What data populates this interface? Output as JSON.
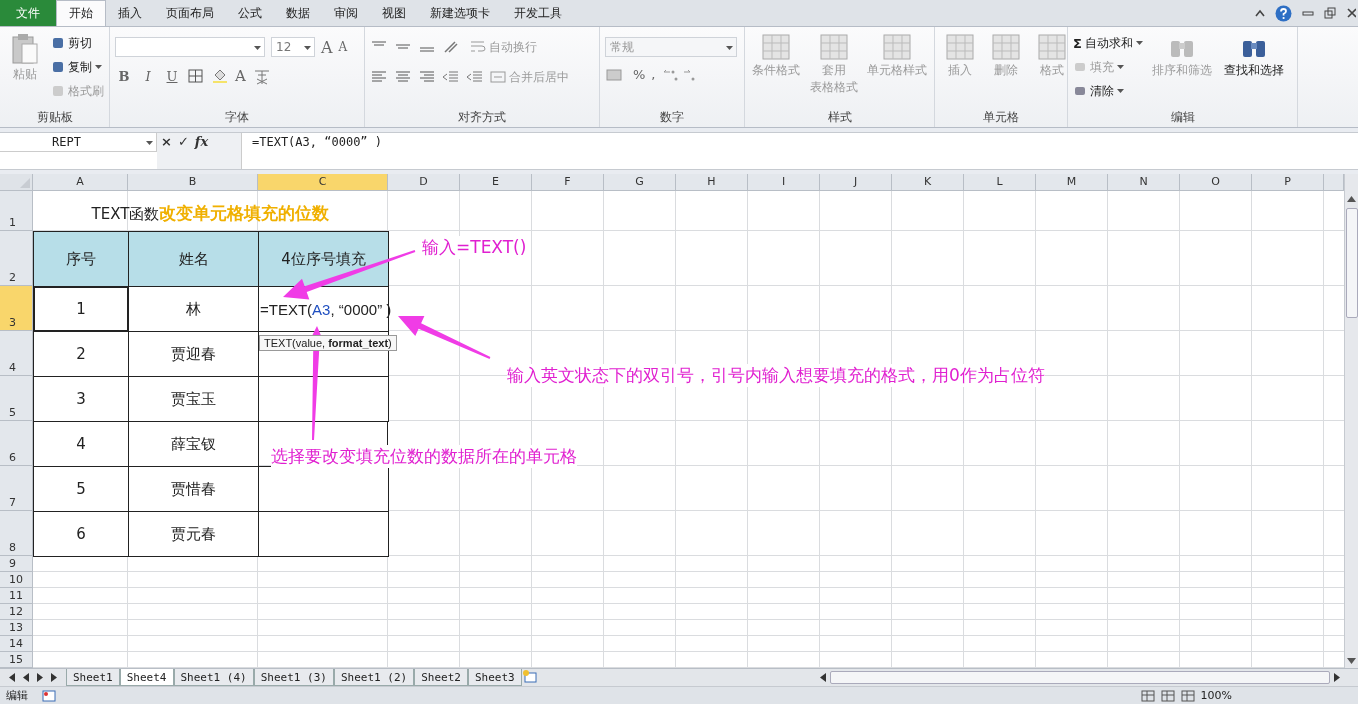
{
  "tabs": [
    {
      "label": "文件",
      "kind": "file",
      "selected": false
    },
    {
      "label": "开始",
      "kind": "tab",
      "selected": true
    },
    {
      "label": "插入",
      "kind": "tab",
      "selected": false
    },
    {
      "label": "页面布局",
      "kind": "tab",
      "selected": false
    },
    {
      "label": "公式",
      "kind": "tab",
      "selected": false
    },
    {
      "label": "数据",
      "kind": "tab",
      "selected": false
    },
    {
      "label": "审阅",
      "kind": "tab",
      "selected": false
    },
    {
      "label": "视图",
      "kind": "tab",
      "selected": false
    },
    {
      "label": "新建选项卡",
      "kind": "tab",
      "selected": false
    },
    {
      "label": "开发工具",
      "kind": "tab",
      "selected": false
    }
  ],
  "clipboard": {
    "label": "剪贴板",
    "paste": {
      "label": "粘贴",
      "disabled": true
    },
    "items": [
      {
        "label": "剪切",
        "disabled": false,
        "caret": false
      },
      {
        "label": "复制",
        "disabled": false,
        "caret": true
      },
      {
        "label": "格式刷",
        "disabled": true,
        "caret": false
      }
    ]
  },
  "font": {
    "label": "字体",
    "size": "12",
    "grow_shrink": [
      "A",
      "A"
    ],
    "styles": [
      "B",
      "I",
      "U"
    ],
    "color_letter": "A"
  },
  "alignment": {
    "label": "对齐方式",
    "wrap": {
      "label": "自动换行",
      "disabled": true
    },
    "merge": {
      "label": "合并后居中",
      "disabled": true
    }
  },
  "number": {
    "label": "数字",
    "format": "常规",
    "symbols": [
      "%",
      ","
    ]
  },
  "styles": {
    "label": "样式",
    "items": [
      {
        "lines": [
          "条件格式"
        ],
        "disabled": true
      },
      {
        "lines": [
          "套用",
          "表格格式"
        ],
        "disabled": true
      },
      {
        "lines": [
          "单元格样式"
        ],
        "disabled": true
      }
    ]
  },
  "cells": {
    "label": "单元格",
    "items": [
      {
        "lines": [
          "插入"
        ],
        "disabled": true
      },
      {
        "lines": [
          "删除"
        ],
        "disabled": true
      },
      {
        "lines": [
          "格式"
        ],
        "disabled": true
      }
    ]
  },
  "editing": {
    "label": "编辑",
    "small": [
      {
        "symbol": "Σ",
        "label": "自动求和",
        "disabled": false
      },
      {
        "label": "填充",
        "disabled": true
      },
      {
        "label": "清除",
        "disabled": false
      }
    ],
    "large": [
      {
        "label": "排序和筛选",
        "disabled": true
      },
      {
        "label": "查找和选择",
        "disabled": false
      }
    ]
  },
  "formula_bar": {
    "name_box": "REPT",
    "buttons": [
      "×",
      "✓",
      "fx"
    ],
    "formula": "=TEXT(A3, “0000” )"
  },
  "columns": [
    {
      "label": "A",
      "selected": false
    },
    {
      "label": "B",
      "selected": false
    },
    {
      "label": "C",
      "selected": true
    },
    {
      "label": "D",
      "selected": false
    },
    {
      "label": "E",
      "selected": false
    },
    {
      "label": "F",
      "selected": false
    },
    {
      "label": "G",
      "selected": false
    },
    {
      "label": "H",
      "selected": false
    },
    {
      "label": "I",
      "selected": false
    },
    {
      "label": "J",
      "selected": false
    },
    {
      "label": "K",
      "selected": false
    },
    {
      "label": "L",
      "selected": false
    },
    {
      "label": "M",
      "selected": false
    },
    {
      "label": "N",
      "selected": false
    },
    {
      "label": "O",
      "selected": false
    },
    {
      "label": "P",
      "selected": false
    }
  ],
  "row_headers": [
    {
      "label": "1",
      "selected": false
    },
    {
      "label": "2",
      "selected": false
    },
    {
      "label": "3",
      "selected": true
    },
    {
      "label": "4",
      "selected": false
    },
    {
      "label": "5",
      "selected": false
    },
    {
      "label": "6",
      "selected": false
    },
    {
      "label": "7",
      "selected": false
    },
    {
      "label": "8",
      "selected": false
    },
    {
      "label": "9",
      "selected": false
    },
    {
      "label": "10",
      "selected": false
    },
    {
      "label": "11",
      "selected": false
    },
    {
      "label": "12",
      "selected": false
    },
    {
      "label": "13",
      "selected": false
    },
    {
      "label": "14",
      "selected": false
    },
    {
      "label": "15",
      "selected": false
    }
  ],
  "sheet": {
    "title": "TEXT函数**改变单元格填充的位数**",
    "headers": [
      "序号",
      "姓名",
      "4位序号填充"
    ],
    "rows": [
      {
        "no": "1",
        "name": "林"
      },
      {
        "no": "2",
        "name": "贾迎春"
      },
      {
        "no": "3",
        "name": "贾宝玉"
      },
      {
        "no": "4",
        "name": "薛宝钗"
      },
      {
        "no": "5",
        "name": "贾惜春"
      },
      {
        "no": "6",
        "name": "贾元春"
      }
    ],
    "cell_edit": {
      "before": "=TEXT(",
      "ref": "A3",
      "after": ", “0000” )"
    },
    "tooltip": "TEXT(value, **format_text**)"
  },
  "annotations": [
    "输入=TEXT()",
    "输入英文状态下的双引号，引号内输入想要填充的格式，用0作为占位符",
    "选择要改变填充位数的数据所在的单元格"
  ],
  "sheet_tabs": [
    {
      "label": "Sheet1",
      "selected": false
    },
    {
      "label": "Sheet4",
      "selected": true
    },
    {
      "label": "Sheet1 (4)",
      "selected": false
    },
    {
      "label": "Sheet1 (3)",
      "selected": false
    },
    {
      "label": "Sheet1 (2)",
      "selected": false
    },
    {
      "label": "Sheet2",
      "selected": false
    },
    {
      "label": "Sheet3",
      "selected": false
    }
  ],
  "status_bar": {
    "mode": "编辑",
    "zoom": "100%"
  }
}
